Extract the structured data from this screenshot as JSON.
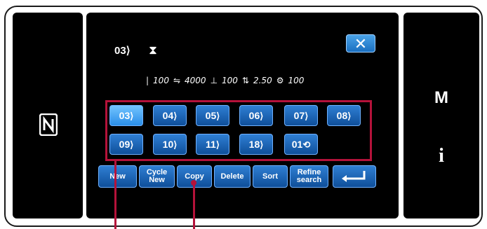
{
  "side": {
    "m_label": "M",
    "i_label": "i"
  },
  "header": {
    "selected_pattern": "03",
    "close_label": "✕"
  },
  "status": {
    "needle": "100",
    "speed": "4000",
    "presser": "100",
    "pitch": "2.50",
    "tension": "100"
  },
  "patterns": [
    "03",
    "04",
    "05",
    "06",
    "07",
    "08",
    "09",
    "10",
    "11",
    "18",
    "01"
  ],
  "buttons": {
    "new": "New",
    "cycle_new": "Cycle New",
    "copy": "Copy",
    "delete": "Delete",
    "sort": "Sort",
    "refine_search": "Refine search"
  },
  "colors": {
    "accent": "#1a6fc0",
    "callout": "#b4123a"
  }
}
